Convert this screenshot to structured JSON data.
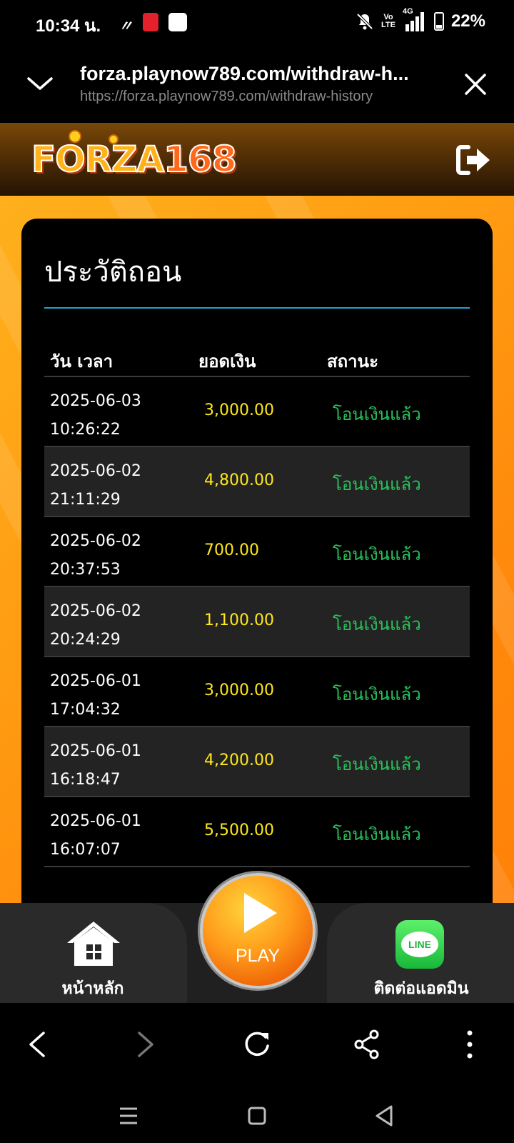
{
  "status_bar": {
    "time": "10:34 น.",
    "volte_top": "Vo",
    "volte_bottom": "LTE",
    "network": "4G",
    "battery": "22%"
  },
  "browser": {
    "page_title": "forza.playnow789.com/withdraw-h...",
    "url": "https://forza.playnow789.com/withdraw-history"
  },
  "site": {
    "logo_text": "FORZA",
    "logo_number": "168"
  },
  "withdraw_history": {
    "title": "ประวัติถอน",
    "columns": [
      "วัน เวลา",
      "ยอดเงิน",
      "สถานะ"
    ],
    "rows": [
      {
        "date": "2025-06-03",
        "time": "10:26:22",
        "amount": "3,000.00",
        "status": "โอนเงินแล้ว"
      },
      {
        "date": "2025-06-02",
        "time": "21:11:29",
        "amount": "4,800.00",
        "status": "โอนเงินแล้ว"
      },
      {
        "date": "2025-06-02",
        "time": "20:37:53",
        "amount": "700.00",
        "status": "โอนเงินแล้ว"
      },
      {
        "date": "2025-06-02",
        "time": "20:24:29",
        "amount": "1,100.00",
        "status": "โอนเงินแล้ว"
      },
      {
        "date": "2025-06-01",
        "time": "17:04:32",
        "amount": "3,000.00",
        "status": "โอนเงินแล้ว"
      },
      {
        "date": "2025-06-01",
        "time": "16:18:47",
        "amount": "4,200.00",
        "status": "โอนเงินแล้ว"
      },
      {
        "date": "2025-06-01",
        "time": "16:07:07",
        "amount": "5,500.00",
        "status": "โอนเงินแล้ว"
      }
    ]
  },
  "bottom_nav": {
    "home_label": "หน้าหลัก",
    "play_label": "PLAY",
    "line_badge": "LINE",
    "contact_label": "ติดต่อแอดมิน"
  },
  "colors": {
    "accent_orange": "#ff9c12",
    "amount_yellow": "#ffe81a",
    "status_green": "#27c25a",
    "divider_blue": "#1fa5d8"
  }
}
